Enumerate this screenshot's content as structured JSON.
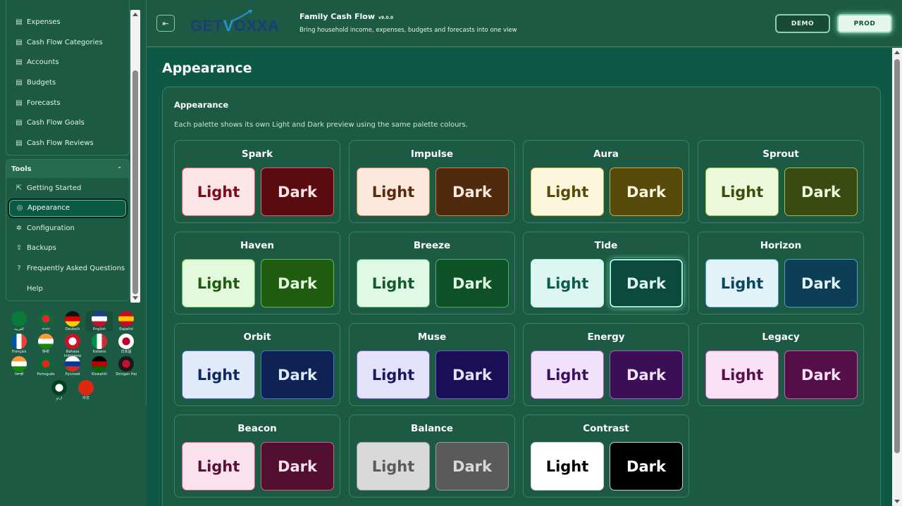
{
  "sidebar": {
    "top_items": [
      {
        "label": "Expenses",
        "icon": "document-icon"
      },
      {
        "label": "Cash Flow Categories",
        "icon": "document-icon"
      },
      {
        "label": "Accounts",
        "icon": "document-icon"
      },
      {
        "label": "Budgets",
        "icon": "document-icon"
      },
      {
        "label": "Forecasts",
        "icon": "document-icon"
      },
      {
        "label": "Cash Flow Goals",
        "icon": "document-icon"
      },
      {
        "label": "Cash Flow Reviews",
        "icon": "document-icon"
      }
    ],
    "tools_label": "Tools",
    "tools_toggle": "⌃",
    "tools_items": [
      {
        "label": "Getting Started",
        "icon": "external-icon"
      },
      {
        "label": "Appearance",
        "icon": "palette-icon"
      },
      {
        "label": "Configuration",
        "icon": "gear-icon"
      },
      {
        "label": "Backups",
        "icon": "upload-icon"
      },
      {
        "label": "Frequently Asked Questions",
        "icon": "question-icon"
      },
      {
        "label": "Help",
        "icon": ""
      }
    ]
  },
  "languages": [
    {
      "label": "العربية",
      "colors": [
        "#0a7a3a",
        "#0a7a3a"
      ]
    },
    {
      "label": "বাংলা",
      "colors": [
        "#0a6a3a",
        "#e0262f"
      ]
    },
    {
      "label": "Deutsch",
      "colors": [
        "#111111",
        "#dd0000",
        "#ffce00"
      ]
    },
    {
      "label": "English",
      "colors": [
        "#1e3a8a",
        "#ffffff",
        "#c8102e"
      ]
    },
    {
      "label": "Español",
      "colors": [
        "#c60b1e",
        "#ffc400",
        "#c60b1e"
      ]
    },
    {
      "label": "Français",
      "colors": [
        "#0055a4",
        "#ffffff",
        "#ef4135"
      ]
    },
    {
      "label": "हिन्दी",
      "colors": [
        "#ff9933",
        "#ffffff",
        "#138808"
      ]
    },
    {
      "label": "Bahasa Indonesia",
      "colors": [
        "#ce1126",
        "#ffffff"
      ]
    },
    {
      "label": "Italiano",
      "colors": [
        "#009246",
        "#ffffff",
        "#ce2b37"
      ]
    },
    {
      "label": "日本語",
      "colors": [
        "#ffffff",
        "#bc002d"
      ]
    },
    {
      "label": "ਪੰਜਾਬੀ",
      "colors": [
        "#ff9933",
        "#ffffff",
        "#138808"
      ]
    },
    {
      "label": "Português",
      "colors": [
        "#046a38",
        "#da291c"
      ]
    },
    {
      "label": "Русский",
      "colors": [
        "#ffffff",
        "#0039a6",
        "#d52b1e"
      ]
    },
    {
      "label": "Kiswahili",
      "colors": [
        "#000000",
        "#bb0000",
        "#006600"
      ]
    },
    {
      "label": "Shingan Hai",
      "colors": [
        "#1a1a1a",
        "#c8102e"
      ]
    },
    {
      "label": "اردو",
      "colors": [
        "#01411c",
        "#ffffff"
      ]
    },
    {
      "label": "中文",
      "colors": [
        "#de2910",
        "#de2910"
      ]
    }
  ],
  "header": {
    "collapse_icon": "⇤",
    "logo_text_a": "GET",
    "logo_text_b": "V",
    "logo_text_c": "OXXA",
    "app_title": "Family Cash Flow",
    "app_version": "v9.0.0",
    "app_desc": "Bring household income, expenses, budgets and forecasts into one view",
    "demo_label": "DEMO",
    "prod_label": "PROD"
  },
  "main": {
    "page_title": "Appearance",
    "card_title": "Appearance",
    "card_desc": "Each palette shows its own Light and Dark preview using the same palette colours.",
    "light_label": "Light",
    "dark_label": "Dark",
    "palettes": [
      {
        "name": "Spark",
        "light_bg": "#fde4e6",
        "light_fg": "#7a0d1c",
        "dark_bg": "#5a0b10",
        "dark_fg": "#fde4e6",
        "border": "#e06070"
      },
      {
        "name": "Impulse",
        "light_bg": "#fde8dc",
        "light_fg": "#5a2a0e",
        "dark_bg": "#4f2a0f",
        "dark_fg": "#fde8dc",
        "border": "#d0804a"
      },
      {
        "name": "Aura",
        "light_bg": "#fbf6dc",
        "light_fg": "#5a4a08",
        "dark_bg": "#574a0b",
        "dark_fg": "#fbf6dc",
        "border": "#c8b040"
      },
      {
        "name": "Sprout",
        "light_bg": "#eef9dc",
        "light_fg": "#3c4e10",
        "dark_bg": "#3a4a10",
        "dark_fg": "#eef9dc",
        "border": "#9cc050"
      },
      {
        "name": "Haven",
        "light_bg": "#e3f9dc",
        "light_fg": "#235a12",
        "dark_bg": "#1f5c10",
        "dark_fg": "#e3f9dc",
        "border": "#5cc050"
      },
      {
        "name": "Breeze",
        "light_bg": "#e0f8e6",
        "light_fg": "#145a2a",
        "dark_bg": "#0f5126",
        "dark_fg": "#e0f8e6",
        "border": "#4ab070"
      },
      {
        "name": "Tide",
        "light_bg": "#dcf7f2",
        "light_fg": "#0e5a4c",
        "dark_bg": "#0d4a3e",
        "dark_fg": "#dcf7f2",
        "border": "#a8f4dc"
      },
      {
        "name": "Horizon",
        "light_bg": "#e1f2f8",
        "light_fg": "#0d4560",
        "dark_bg": "#0c3e55",
        "dark_fg": "#e1f2f8",
        "border": "#4aa0c8"
      },
      {
        "name": "Orbit",
        "light_bg": "#e1eafb",
        "light_fg": "#0f2a5e",
        "dark_bg": "#0e2354",
        "dark_fg": "#e1eafb",
        "border": "#4a70c8"
      },
      {
        "name": "Muse",
        "light_bg": "#e4e1fb",
        "light_fg": "#1f1560",
        "dark_bg": "#1a0f54",
        "dark_fg": "#e4e1fb",
        "border": "#7060c8"
      },
      {
        "name": "Energy",
        "light_bg": "#f1e1fb",
        "light_fg": "#3e1060",
        "dark_bg": "#3a0f56",
        "dark_fg": "#f1e1fb",
        "border": "#a060c8"
      },
      {
        "name": "Legacy",
        "light_bg": "#fbe1f5",
        "light_fg": "#56104a",
        "dark_bg": "#540f48",
        "dark_fg": "#fbe1f5",
        "border": "#c860b0"
      },
      {
        "name": "Beacon",
        "light_bg": "#fbe1ec",
        "light_fg": "#5a1036",
        "dark_bg": "#520f30",
        "dark_fg": "#fbe1ec",
        "border": "#c8608e"
      },
      {
        "name": "Balance",
        "light_bg": "#d9d9d9",
        "light_fg": "#5a5a5a",
        "dark_bg": "#5a5a5a",
        "dark_fg": "#d9d9d9",
        "border": "#9a9a9a"
      },
      {
        "name": "Contrast",
        "light_bg": "#ffffff",
        "light_fg": "#000000",
        "dark_bg": "#000000",
        "dark_fg": "#ffffff",
        "border": "#cccccc"
      }
    ]
  }
}
